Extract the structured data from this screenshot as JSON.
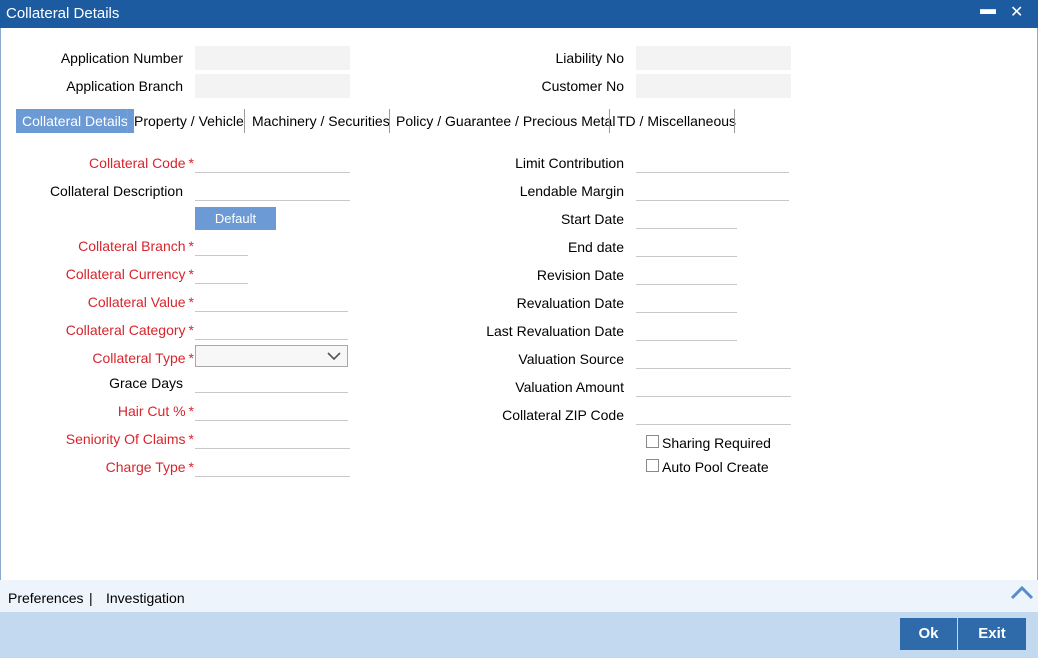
{
  "window": {
    "title": "Collateral Details",
    "minimize_icon": "minimize-icon",
    "close_icon": "close-icon"
  },
  "header": {
    "application_number_label": "Application Number",
    "application_branch_label": "Application Branch",
    "liability_no_label": "Liability No",
    "customer_no_label": "Customer No",
    "application_number_value": "",
    "application_branch_value": "",
    "liability_no_value": "",
    "customer_no_value": ""
  },
  "tabs": [
    {
      "label": "Collateral Details",
      "active": true
    },
    {
      "label": "Property / Vehicle",
      "active": false
    },
    {
      "label": "Machinery / Securities",
      "active": false
    },
    {
      "label": "Policy / Guarantee / Precious Metal",
      "active": false
    },
    {
      "label": "TD / Miscellaneous",
      "active": false
    }
  ],
  "left_form": {
    "collateral_code": {
      "label": "Collateral Code",
      "required": "*",
      "value": ""
    },
    "collateral_description": {
      "label": "Collateral Description",
      "value": ""
    },
    "default_button": "Default",
    "collateral_branch": {
      "label": "Collateral Branch",
      "required": "*",
      "value": ""
    },
    "collateral_currency": {
      "label": "Collateral Currency",
      "required": "*",
      "value": ""
    },
    "collateral_value": {
      "label": "Collateral Value",
      "required": "*",
      "value": ""
    },
    "collateral_category": {
      "label": "Collateral Category",
      "required": "*",
      "value": ""
    },
    "collateral_type": {
      "label": "Collateral Type",
      "required": "*",
      "selected": ""
    },
    "grace_days": {
      "label": "Grace Days",
      "value": ""
    },
    "hair_cut": {
      "label": "Hair Cut %",
      "required": "*",
      "value": ""
    },
    "seniority_of_claims": {
      "label": "Seniority Of Claims",
      "required": "*",
      "value": ""
    },
    "charge_type": {
      "label": "Charge Type",
      "required": "*",
      "value": ""
    }
  },
  "right_form": {
    "limit_contribution": {
      "label": "Limit Contribution",
      "value": ""
    },
    "lendable_margin": {
      "label": "Lendable Margin",
      "value": ""
    },
    "start_date": {
      "label": "Start Date",
      "value": ""
    },
    "end_date": {
      "label": "End date",
      "value": ""
    },
    "revision_date": {
      "label": "Revision Date",
      "value": ""
    },
    "revaluation_date": {
      "label": "Revaluation Date",
      "value": ""
    },
    "last_revaluation_date": {
      "label": "Last Revaluation Date",
      "value": ""
    },
    "valuation_source": {
      "label": "Valuation Source",
      "value": ""
    },
    "valuation_amount": {
      "label": "Valuation Amount",
      "value": ""
    },
    "collateral_zip_code": {
      "label": "Collateral ZIP Code",
      "value": ""
    },
    "sharing_required": {
      "label": "Sharing Required",
      "checked": false
    },
    "auto_pool_create": {
      "label": "Auto Pool Create",
      "checked": false
    }
  },
  "footer": {
    "preferences": "Preferences",
    "separator": "|",
    "investigation": "Investigation",
    "ok": "Ok",
    "exit": "Exit"
  },
  "colors": {
    "title_bar": "#1d5ba0",
    "active_tab": "#6b9ad4",
    "required_label": "#d9242c",
    "footer_bar": "#c3d9ef",
    "footer_button": "#2f6aab"
  }
}
